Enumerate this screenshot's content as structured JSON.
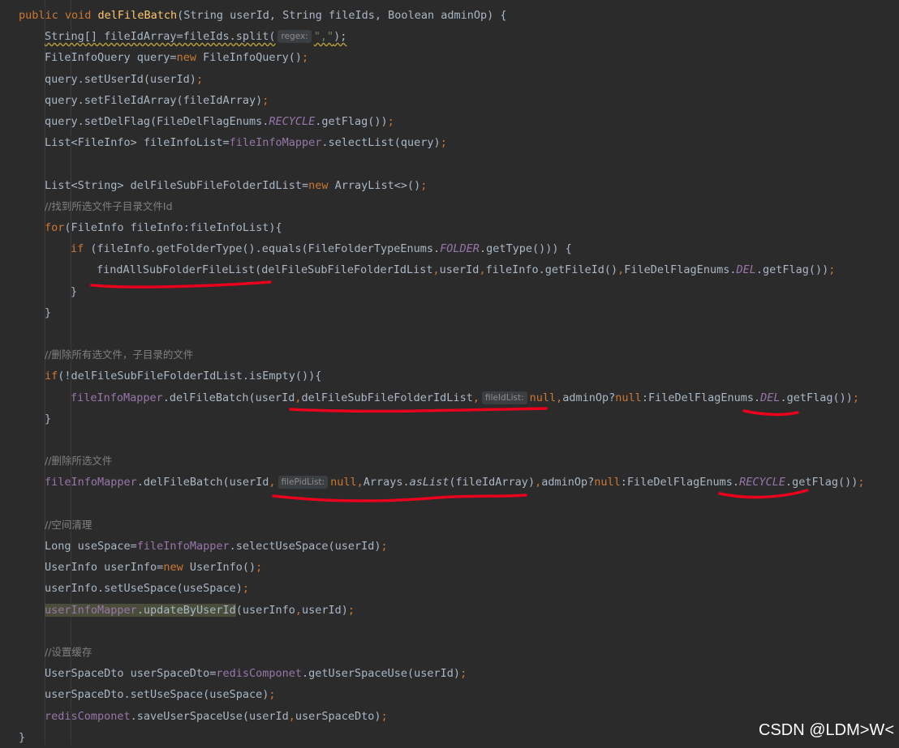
{
  "editor": {
    "lines": [
      {
        "indent": 0,
        "segs": [
          {
            "t": "public void ",
            "c": "k"
          },
          {
            "t": "delFileBatch",
            "c": "m"
          },
          {
            "t": "(String userId, String fileIds, Boolean adminOp) {",
            "c": ""
          }
        ]
      },
      {
        "indent": 1,
        "segs": [
          {
            "t": "String[] fileIdArray=fileIds.split(",
            "c": "warn"
          },
          {
            "t": "regex:",
            "c": "hint"
          },
          {
            "t": "\",\"",
            "c": "s warn"
          },
          {
            "t": ");",
            "c": "warn"
          }
        ]
      },
      {
        "indent": 1,
        "segs": [
          {
            "t": "FileInfoQuery query=",
            "c": ""
          },
          {
            "t": "new ",
            "c": "k"
          },
          {
            "t": "FileInfoQuery()",
            "c": ""
          },
          {
            "t": ";",
            "c": "k"
          }
        ]
      },
      {
        "indent": 1,
        "segs": [
          {
            "t": "query.setUserId(userId)",
            "c": ""
          },
          {
            "t": ";",
            "c": "k"
          }
        ]
      },
      {
        "indent": 1,
        "segs": [
          {
            "t": "query.setFileIdArray(fileIdArray)",
            "c": ""
          },
          {
            "t": ";",
            "c": "k"
          }
        ]
      },
      {
        "indent": 1,
        "segs": [
          {
            "t": "query.setDelFlag(FileDelFlagEnums.",
            "c": ""
          },
          {
            "t": "RECYCLE",
            "c": "fi"
          },
          {
            "t": ".getFlag())",
            "c": ""
          },
          {
            "t": ";",
            "c": "k"
          }
        ]
      },
      {
        "indent": 1,
        "segs": [
          {
            "t": "List<FileInfo> fileInfoList=",
            "c": ""
          },
          {
            "t": "fileInfoMapper",
            "c": "f"
          },
          {
            "t": ".selectList(query)",
            "c": ""
          },
          {
            "t": ";",
            "c": "k"
          }
        ]
      },
      {
        "indent": 0,
        "segs": []
      },
      {
        "indent": 1,
        "segs": [
          {
            "t": "List<String> delFileSubFileFolderIdList=",
            "c": ""
          },
          {
            "t": "new ",
            "c": "k"
          },
          {
            "t": "ArrayList<>()",
            "c": ""
          },
          {
            "t": ";",
            "c": "k"
          }
        ]
      },
      {
        "indent": 1,
        "segs": [
          {
            "t": "//找到所选文件子目录文件Id",
            "c": "c"
          }
        ]
      },
      {
        "indent": 1,
        "segs": [
          {
            "t": "for",
            "c": "k"
          },
          {
            "t": "(FileInfo fileInfo:fileInfoList){",
            "c": ""
          }
        ]
      },
      {
        "indent": 2,
        "segs": [
          {
            "t": "if ",
            "c": "k"
          },
          {
            "t": "(fileInfo.getFolderType().equals(FileFolderTypeEnums.",
            "c": ""
          },
          {
            "t": "FOLDER",
            "c": "fi"
          },
          {
            "t": ".getType())) {",
            "c": ""
          }
        ]
      },
      {
        "indent": 3,
        "segs": [
          {
            "t": "findAllSubFolderFileList(delFileSubFileFolderIdList",
            "c": ""
          },
          {
            "t": ",",
            "c": "k"
          },
          {
            "t": "userId",
            "c": ""
          },
          {
            "t": ",",
            "c": "k"
          },
          {
            "t": "fileInfo.getFileId()",
            "c": ""
          },
          {
            "t": ",",
            "c": "k"
          },
          {
            "t": "FileDelFlagEnums.",
            "c": ""
          },
          {
            "t": "DEL",
            "c": "fi"
          },
          {
            "t": ".getFlag())",
            "c": ""
          },
          {
            "t": ";",
            "c": "k"
          }
        ]
      },
      {
        "indent": 2,
        "segs": [
          {
            "t": "}",
            "c": ""
          }
        ]
      },
      {
        "indent": 1,
        "segs": [
          {
            "t": "}",
            "c": ""
          }
        ]
      },
      {
        "indent": 0,
        "segs": []
      },
      {
        "indent": 1,
        "segs": [
          {
            "t": "//删除所有选文件，子目录的文件",
            "c": "c"
          }
        ]
      },
      {
        "indent": 1,
        "segs": [
          {
            "t": "if",
            "c": "k"
          },
          {
            "t": "(!delFileSubFileFolderIdList.isEmpty()){",
            "c": ""
          }
        ]
      },
      {
        "indent": 2,
        "segs": [
          {
            "t": "fileInfoMapper",
            "c": "f"
          },
          {
            "t": ".delFileBatch(userId",
            "c": ""
          },
          {
            "t": ",",
            "c": "k"
          },
          {
            "t": "delFileSubFileFolderIdList",
            "c": ""
          },
          {
            "t": ",",
            "c": "k"
          },
          {
            "t": "fileIdList:",
            "c": "hint"
          },
          {
            "t": "null,",
            "c": "k"
          },
          {
            "t": "adminOp?",
            "c": ""
          },
          {
            "t": "null",
            "c": "k"
          },
          {
            "t": ":FileDelFlagEnums.",
            "c": ""
          },
          {
            "t": "DEL",
            "c": "fi"
          },
          {
            "t": ".getFlag())",
            "c": ""
          },
          {
            "t": ";",
            "c": "k"
          }
        ]
      },
      {
        "indent": 1,
        "segs": [
          {
            "t": "}",
            "c": ""
          }
        ]
      },
      {
        "indent": 0,
        "segs": []
      },
      {
        "indent": 1,
        "segs": [
          {
            "t": "//删除所选文件",
            "c": "c"
          }
        ]
      },
      {
        "indent": 1,
        "segs": [
          {
            "t": "fileInfoMapper",
            "c": "f"
          },
          {
            "t": ".delFileBatch(userId",
            "c": ""
          },
          {
            "t": ",",
            "c": "k"
          },
          {
            "t": "filePidList:",
            "c": "hint"
          },
          {
            "t": "null,",
            "c": "k"
          },
          {
            "t": "Arrays.",
            "c": ""
          },
          {
            "t": "asList",
            "c": "si"
          },
          {
            "t": "(fileIdArray)",
            "c": ""
          },
          {
            "t": ",",
            "c": "k"
          },
          {
            "t": "adminOp?",
            "c": ""
          },
          {
            "t": "null",
            "c": "k"
          },
          {
            "t": ":FileDelFlagEnums.",
            "c": ""
          },
          {
            "t": "RECYCLE",
            "c": "fi"
          },
          {
            "t": ".getFlag())",
            "c": ""
          },
          {
            "t": ";",
            "c": "k"
          }
        ]
      },
      {
        "indent": 0,
        "segs": []
      },
      {
        "indent": 1,
        "segs": [
          {
            "t": "//空间清理",
            "c": "c"
          }
        ]
      },
      {
        "indent": 1,
        "segs": [
          {
            "t": "Long useSpace=",
            "c": ""
          },
          {
            "t": "fileInfoMapper",
            "c": "f"
          },
          {
            "t": ".selectUseSpace(userId)",
            "c": ""
          },
          {
            "t": ";",
            "c": "k"
          }
        ]
      },
      {
        "indent": 1,
        "segs": [
          {
            "t": "UserInfo userInfo=",
            "c": ""
          },
          {
            "t": "new ",
            "c": "k"
          },
          {
            "t": "UserInfo()",
            "c": ""
          },
          {
            "t": ";",
            "c": "k"
          }
        ]
      },
      {
        "indent": 1,
        "segs": [
          {
            "t": "userInfo.setUseSpace(useSpace)",
            "c": ""
          },
          {
            "t": ";",
            "c": "k"
          }
        ]
      },
      {
        "indent": 1,
        "segs": [
          {
            "t": "userInfoMapper",
            "c": "f hl"
          },
          {
            "t": ".updateByUserId",
            "c": "hl"
          },
          {
            "t": "(userInfo",
            "c": ""
          },
          {
            "t": ",",
            "c": "k"
          },
          {
            "t": "userId)",
            "c": ""
          },
          {
            "t": ";",
            "c": "k"
          }
        ]
      },
      {
        "indent": 0,
        "segs": []
      },
      {
        "indent": 1,
        "segs": [
          {
            "t": "//设置缓存",
            "c": "c"
          }
        ]
      },
      {
        "indent": 1,
        "segs": [
          {
            "t": "UserSpaceDto userSpaceDto=",
            "c": ""
          },
          {
            "t": "redisComponet",
            "c": "f"
          },
          {
            "t": ".getUserSpaceUse(userId)",
            "c": ""
          },
          {
            "t": ";",
            "c": "k"
          }
        ]
      },
      {
        "indent": 1,
        "segs": [
          {
            "t": "userSpaceDto.setUseSpace(useSpace)",
            "c": ""
          },
          {
            "t": ";",
            "c": "k"
          }
        ]
      },
      {
        "indent": 1,
        "segs": [
          {
            "t": "redisComponet",
            "c": "f"
          },
          {
            "t": ".saveUserSpaceUse(userId",
            "c": ""
          },
          {
            "t": ",",
            "c": "k"
          },
          {
            "t": "userSpaceDto)",
            "c": ""
          },
          {
            "t": ";",
            "c": "k"
          }
        ]
      },
      {
        "indent": 0,
        "segs": [
          {
            "t": "}",
            "c": ""
          }
        ]
      }
    ]
  },
  "watermark": "CSDN @LDM>W<",
  "colors": {
    "background": "#2b2b2b",
    "keyword": "#cc7832",
    "method": "#ffc66d",
    "field": "#9876aa",
    "string": "#6a8759",
    "comment": "#808080",
    "annotation": "#e8001c"
  }
}
